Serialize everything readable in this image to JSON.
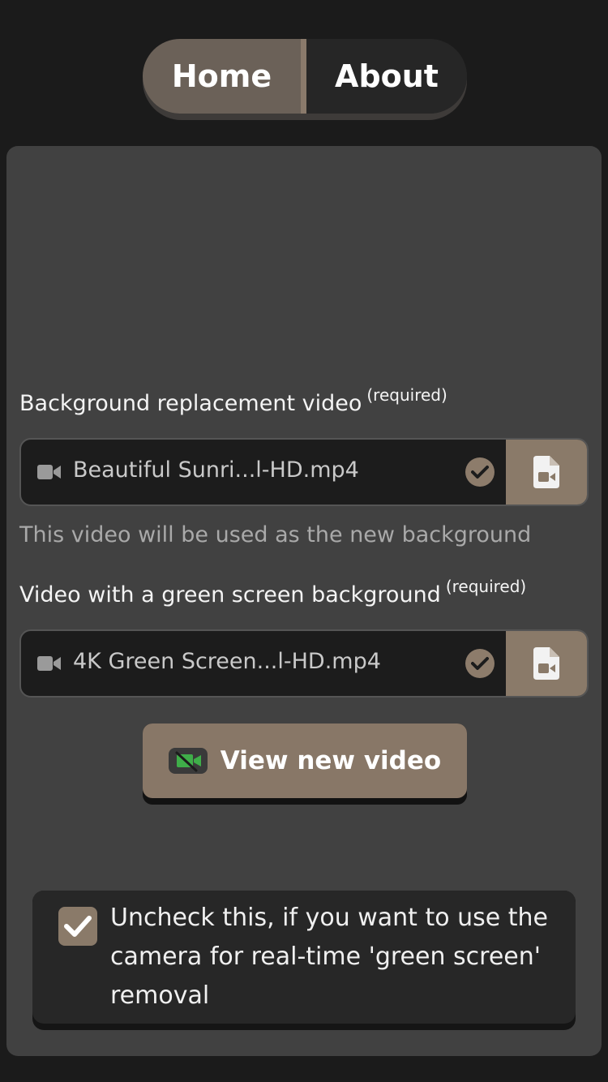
{
  "nav": {
    "home_label": "Home",
    "about_label": "About"
  },
  "background_video": {
    "label": "Background replacement video",
    "required": "(required)",
    "file_name": "Beautiful Sunri...l-HD.mp4",
    "hint": "This video will be used as the new background"
  },
  "green_video": {
    "label": "Video with a green screen background",
    "required": "(required)",
    "file_name": "4K Green Screen...l-HD.mp4"
  },
  "view_button": {
    "label": "View new video"
  },
  "camera_toggle": {
    "checked": true,
    "text": "Uncheck this, if you want to use the camera for real-time 'green screen' removal"
  },
  "colors": {
    "accent": "#8a7a69",
    "panel": "#414141",
    "page_bg": "#1b1b1b",
    "green_icon": "#3fae49"
  }
}
